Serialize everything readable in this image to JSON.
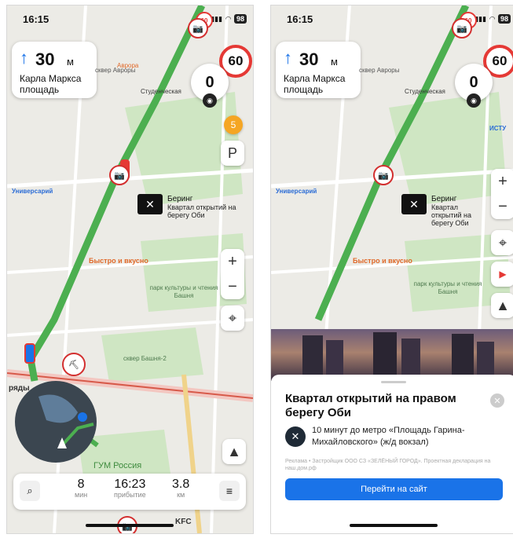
{
  "colors": {
    "route": "#4caf50",
    "limit_ring": "#e53935",
    "accent": "#1a73e8"
  },
  "left": {
    "status": {
      "time": "16:15",
      "battery": "98"
    },
    "maneuver": {
      "distance": "30",
      "unit": "м",
      "street": "Карла Маркса площадь"
    },
    "speed_limit": "60",
    "current_speed": "0",
    "speed_camera_limit": "60",
    "poi_badge": "5",
    "parking": "P",
    "labels": {
      "skver_avrory": "сквер Авроры",
      "studencheskaya": "Студенческая",
      "universariy": "Универсарий",
      "bering_name": "Беринг",
      "bering_desc": "Квартал открытий на берегу Оби",
      "bystro": "Быстро и вкусно",
      "park": "парк культуры и чтения Башня",
      "skver_bashnya": "сквер Башня-2",
      "gum": "ГУМ Россия",
      "kfc": "KFC",
      "ryady": "ряды",
      "avrora_top": "Аврора"
    },
    "trip": {
      "duration_value": "8",
      "duration_unit": "мин",
      "arrival_value": "16:23",
      "arrival_unit": "прибытие",
      "distance_value": "3.8",
      "distance_unit": "км"
    }
  },
  "right": {
    "status": {
      "time": "16:15",
      "battery": "98"
    },
    "maneuver": {
      "distance": "30",
      "unit": "м",
      "street": "Карла Маркса площадь"
    },
    "speed_limit": "60",
    "current_speed": "0",
    "speed_camera_limit": "60",
    "labels": {
      "skver_avrory": "сквер Авроры",
      "studencheskaya": "Студенческая",
      "universariy": "Универсарий",
      "bering_name": "Беринг",
      "bering_desc": "Квартал открытий на берегу Оби",
      "bystro": "Быстро и вкусно",
      "park": "парк культуры и чтения Башня",
      "istu": "ИСТУ"
    },
    "ad_card": {
      "title": "Квартал открытий на правом берегу Оби",
      "description": "10 минут до метро «Площадь Гарина-Михайловского» (ж/д вокзал)",
      "disclaimer": "Реклама • Застройщик ООО СЗ «ЗЕЛЁНЫЙ ГОРОД». Проектная декларация на наш.дом.рф",
      "cta": "Перейти на сайт"
    }
  }
}
